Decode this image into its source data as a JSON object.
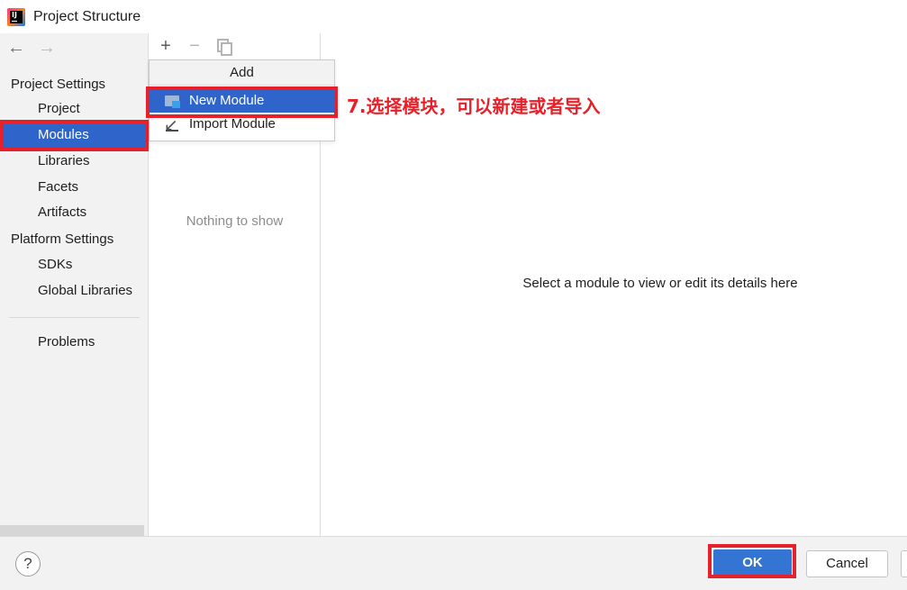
{
  "window": {
    "title": "Project Structure"
  },
  "nav": {
    "back_icon": "arrow-left-icon",
    "forward_icon": "arrow-right-icon"
  },
  "sidebar": {
    "group_project": "Project Settings",
    "items_project": [
      {
        "label": "Project"
      },
      {
        "label": "Modules",
        "selected": true
      },
      {
        "label": "Libraries"
      },
      {
        "label": "Facets"
      },
      {
        "label": "Artifacts"
      }
    ],
    "group_platform": "Platform Settings",
    "items_platform": [
      {
        "label": "SDKs"
      },
      {
        "label": "Global Libraries"
      }
    ],
    "problems": "Problems"
  },
  "module_list": {
    "toolbar_icons": [
      "plus-icon",
      "minus-icon",
      "copy-icon"
    ],
    "empty_text": "Nothing to show"
  },
  "add_popup": {
    "header": "Add",
    "items": [
      {
        "label": "New Module",
        "icon": "folder-icon",
        "selected": true
      },
      {
        "label": "Import Module",
        "icon": "import-icon"
      }
    ]
  },
  "annotation": {
    "text": "7.选择模块，可以新建或者导入",
    "color": "#e8202a"
  },
  "detail": {
    "placeholder": "Select a module to view or edit its details here"
  },
  "footer": {
    "help": "?",
    "ok": "OK",
    "cancel": "Cancel"
  },
  "colors": {
    "selection": "#2f65ca",
    "ok_button": "#3474d3",
    "highlight_box": "#e8202a"
  }
}
